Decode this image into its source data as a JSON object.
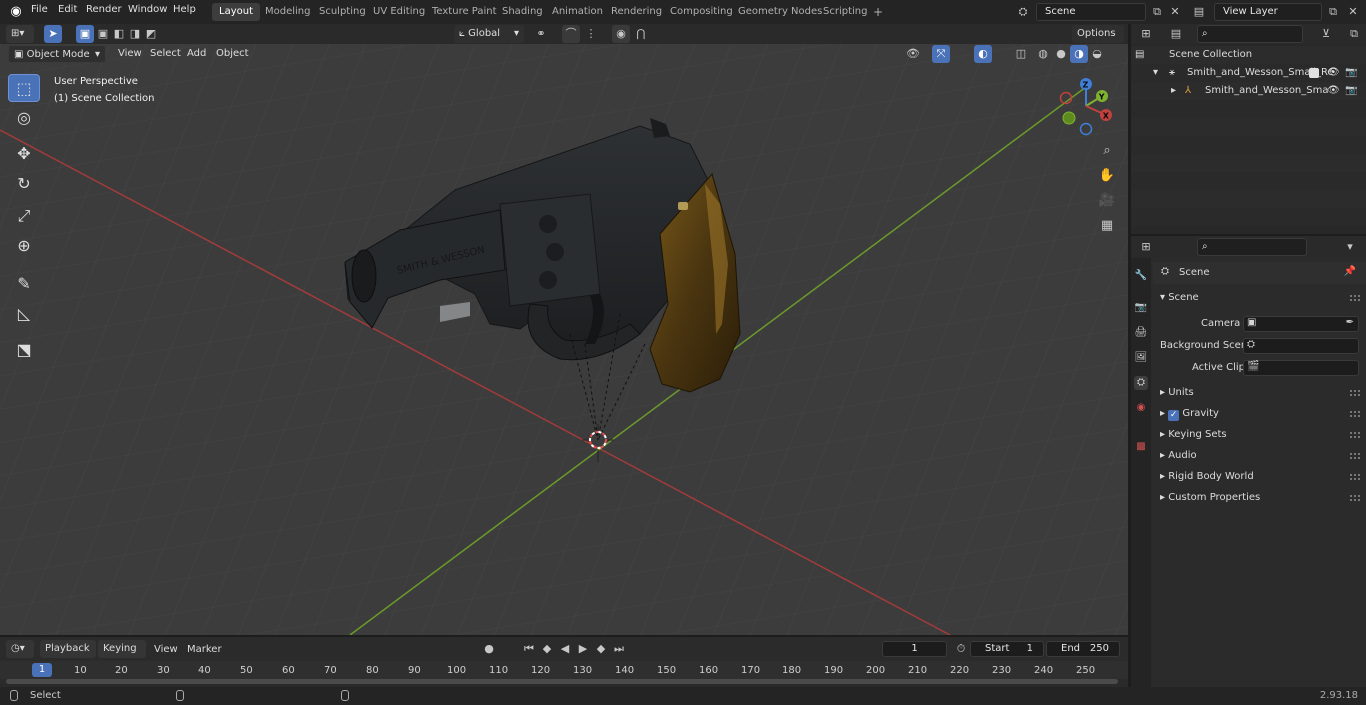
{
  "topbar": {
    "menus": [
      "File",
      "Edit",
      "Render",
      "Window",
      "Help"
    ],
    "workspaces": [
      "Layout",
      "Modeling",
      "Sculpting",
      "UV Editing",
      "Texture Paint",
      "Shading",
      "Animation",
      "Rendering",
      "Compositing",
      "Geometry Nodes",
      "Scripting"
    ],
    "active_workspace": "Layout",
    "add_tab": "+",
    "scene_name": "Scene",
    "view_layer": "View Layer"
  },
  "viewport_header": {
    "mode": "Object Mode",
    "menus": [
      "View",
      "Select",
      "Add",
      "Object"
    ],
    "orientation": "Global",
    "options": "Options"
  },
  "viewport": {
    "overlay_title": "User Perspective",
    "overlay_sub": "(1) Scene Collection",
    "gizmo": {
      "z": "Z",
      "y": "Y",
      "x": "X"
    },
    "engraving": "SMITH & WESSON"
  },
  "outliner": {
    "root": "Scene Collection",
    "items": [
      {
        "label": "Smith_and_Wesson_Small_Re"
      },
      {
        "label": "Smith_and_Wesson_Sma"
      }
    ]
  },
  "properties": {
    "context": "Scene",
    "section": "Scene",
    "rows": [
      {
        "label": "Camera"
      },
      {
        "label": "Background Scene"
      },
      {
        "label": "Active Clip"
      }
    ],
    "panels": [
      "Units",
      "Gravity",
      "Keying Sets",
      "Audio",
      "Rigid Body World",
      "Custom Properties"
    ]
  },
  "timeline": {
    "menus": [
      "Playback",
      "Keying",
      "View",
      "Marker"
    ],
    "current_frame": "1",
    "start_label": "Start",
    "start": "1",
    "end_label": "End",
    "end": "250",
    "ticks": [
      "1",
      "10",
      "20",
      "30",
      "40",
      "50",
      "60",
      "70",
      "80",
      "90",
      "100",
      "110",
      "120",
      "130",
      "140",
      "150",
      "160",
      "170",
      "180",
      "190",
      "200",
      "210",
      "220",
      "230",
      "240",
      "250"
    ]
  },
  "status": {
    "left": "Select",
    "version": "2.93.18"
  },
  "colors": {
    "accent": "#4a72b8",
    "x_axis": "#c0413e",
    "y_axis": "#7fb32f",
    "z_axis": "#3f7fd8"
  }
}
